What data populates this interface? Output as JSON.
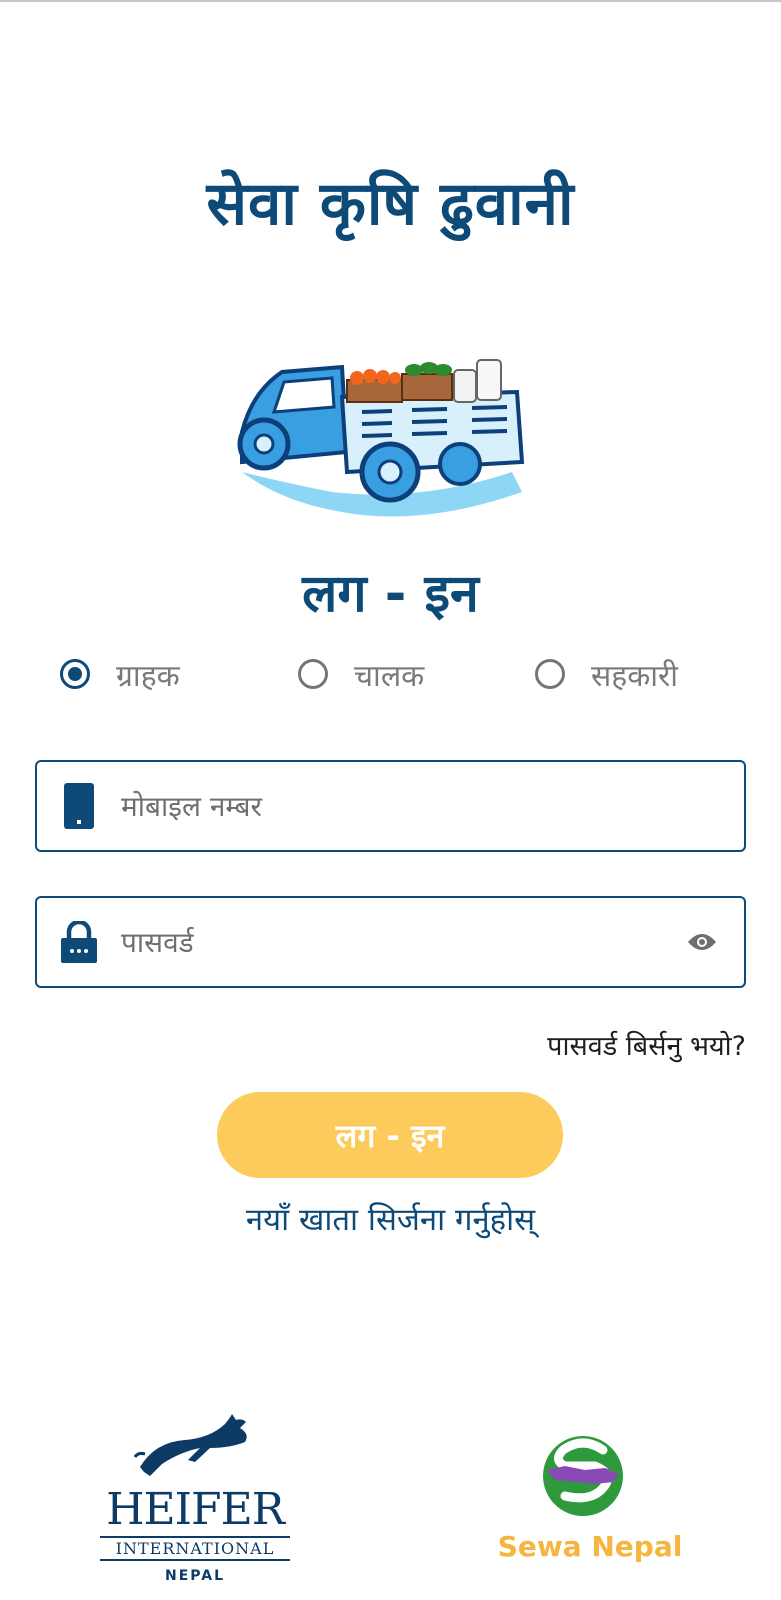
{
  "app": {
    "title": "सेवा कृषि ढुवानी",
    "login_heading": "लग - इन"
  },
  "roles": [
    {
      "label": "ग्राहक",
      "selected": true
    },
    {
      "label": "चालक",
      "selected": false
    },
    {
      "label": "सहकारी",
      "selected": false
    }
  ],
  "form": {
    "mobile_placeholder": "मोबाइल नम्बर",
    "password_placeholder": "पासवर्ड",
    "forgot_password": "पासवर्ड बिर्सनु भयो?",
    "login_button": "लग - इन",
    "create_account": "नयाँ खाता सिर्जना गर्नुहोस्"
  },
  "partners": {
    "heifer_name": "HEIFER",
    "heifer_sub": "INTERNATIONAL",
    "heifer_region": "NEPAL",
    "sewa_name": "Sewa Nepal"
  },
  "colors": {
    "primary": "#0e4a77",
    "button": "#fdca5c",
    "sewa_orange": "#f6b53e",
    "sewa_green": "#2e9a3c"
  },
  "icons": {
    "mobile": "mobile-phone-icon",
    "password": "padlock-icon",
    "toggle_visibility": "eye-icon"
  }
}
